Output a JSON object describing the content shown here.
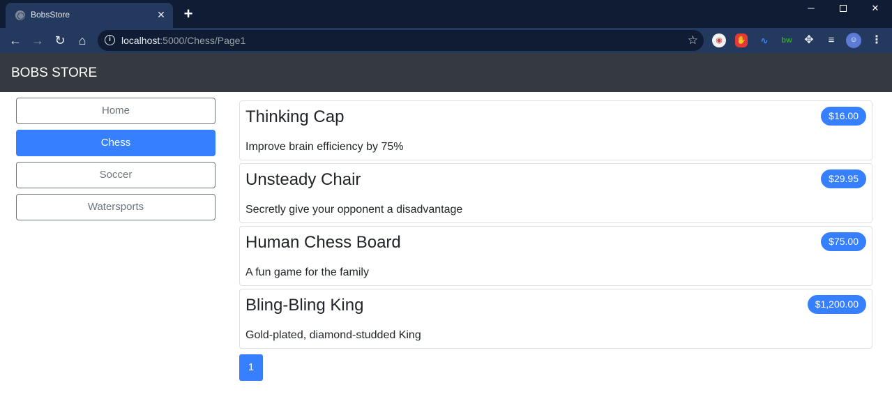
{
  "browser": {
    "tab_title": "BobsStore",
    "url_host": "localhost",
    "url_path": ":5000/Chess/Page1"
  },
  "navbar": {
    "brand": "BOBS STORE"
  },
  "categories": [
    {
      "label": "Home",
      "active": false
    },
    {
      "label": "Chess",
      "active": true
    },
    {
      "label": "Soccer",
      "active": false
    },
    {
      "label": "Watersports",
      "active": false
    }
  ],
  "products": [
    {
      "name": "Thinking Cap",
      "price": "$16.00",
      "description": "Improve brain efficiency by 75%"
    },
    {
      "name": "Unsteady Chair",
      "price": "$29.95",
      "description": "Secretly give your opponent a disadvantage"
    },
    {
      "name": "Human Chess Board",
      "price": "$75.00",
      "description": "A fun game for the family"
    },
    {
      "name": "Bling-Bling King",
      "price": "$1,200.00",
      "description": "Gold-plated, diamond-studded King"
    }
  ],
  "pagination": {
    "current_page": "1"
  },
  "colors": {
    "accent": "#3680ff",
    "navbar": "#343a40"
  }
}
